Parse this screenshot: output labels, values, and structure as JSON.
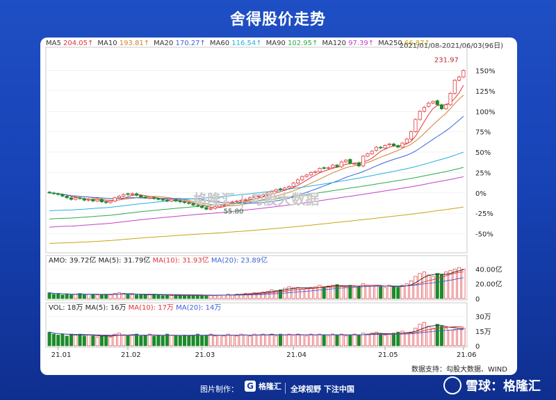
{
  "page": {
    "title": "舍得股价走势",
    "source": "数据支持：勾股大数据、WIND",
    "watermark": "格隆汇 | 勾股大数据"
  },
  "footer": {
    "made_by": "图片制作：",
    "brand": "格隆汇",
    "slogan": "全球视野 下注中国",
    "xueqiu": "雪球：格隆汇"
  },
  "ma_legend": [
    {
      "label": "MA5",
      "value": "204.05↑",
      "color": "#e0343a"
    },
    {
      "label": "MA10",
      "value": "193.81↑",
      "color": "#d08030"
    },
    {
      "label": "MA20",
      "value": "170.27↑",
      "color": "#3a62d8"
    },
    {
      "label": "MA60",
      "value": "116.54↑",
      "color": "#25aee0"
    },
    {
      "label": "MA90",
      "value": "102.95↑",
      "color": "#2ca84a"
    },
    {
      "label": "MA120",
      "value": "97.39↑",
      "color": "#c040c8"
    },
    {
      "label": "MA250",
      "value": "66.87↑",
      "color": "#c8a414"
    }
  ],
  "date_range": "2021/01/08-2021/06/03(96日)",
  "chart_data": [
    {
      "type": "candlestick",
      "yaxis": {
        "ticks": [
          "150%",
          "125%",
          "100%",
          "75%",
          "50%",
          "25%",
          "0%",
          "-25%",
          "-50%"
        ],
        "values": [
          150,
          125,
          100,
          75,
          50,
          25,
          0,
          -25,
          -50
        ],
        "ylim": [
          -70,
          170
        ]
      },
      "annotations": [
        {
          "text": "231.97",
          "x": 95,
          "y": 162
        },
        {
          "text": "55.80",
          "x": 39,
          "y": -20
        }
      ],
      "x_ticks": [
        {
          "label": "21.01",
          "x": 2
        },
        {
          "label": "21.02",
          "x": 18
        },
        {
          "label": "21.03",
          "x": 35
        },
        {
          "label": "21.04",
          "x": 56
        },
        {
          "label": "21.05",
          "x": 77
        },
        {
          "label": "21.06",
          "x": 95
        }
      ],
      "n": 96,
      "closes": [
        0,
        -1,
        -2,
        -4,
        -6,
        -8,
        -6,
        -7,
        -9,
        -8,
        -10,
        -8,
        -11,
        -12,
        -10,
        -6,
        -4,
        -2,
        -2,
        -1,
        -3,
        -5,
        -6,
        -6,
        -7,
        -8,
        -9,
        -10,
        -8,
        -10,
        -11,
        -12,
        -13,
        -15,
        -16,
        -18,
        -20,
        -19,
        -17,
        -15,
        -14,
        -12,
        -11,
        -10,
        -9,
        -8,
        -6,
        -5,
        -4,
        -2,
        0,
        2,
        4,
        4,
        6,
        8,
        12,
        16,
        20,
        22,
        25,
        26,
        30,
        30,
        31,
        34,
        32,
        38,
        40,
        36,
        36,
        33,
        45,
        48,
        51,
        56,
        55,
        58,
        60,
        58,
        56,
        61,
        66,
        75,
        90,
        100,
        105,
        110,
        112,
        108,
        103,
        108,
        122,
        138,
        142,
        150
      ],
      "opens": [
        1,
        0,
        -1,
        -2,
        -4,
        -6,
        -8,
        -6,
        -7,
        -9,
        -8,
        -10,
        -8,
        -11,
        -12,
        -10,
        -6,
        -4,
        -1,
        -2,
        -1,
        -3,
        -5,
        -6,
        -6,
        -7,
        -8,
        -9,
        -10,
        -8,
        -10,
        -11,
        -12,
        -13,
        -15,
        -16,
        -18,
        -20,
        -19,
        -17,
        -15,
        -14,
        -12,
        -11,
        -10,
        -9,
        -8,
        -6,
        -5,
        -4,
        -2,
        0,
        2,
        5,
        4,
        6,
        8,
        12,
        16,
        20,
        22,
        25,
        26,
        31,
        30,
        31,
        34,
        32,
        38,
        41,
        36,
        37,
        33,
        45,
        48,
        52,
        56,
        55,
        59,
        60,
        58,
        56,
        61,
        66,
        75,
        90,
        100,
        106,
        110,
        113,
        108,
        103,
        108,
        122,
        138,
        142
      ]
    },
    {
      "type": "bar",
      "title": "AMO: 39.72亿",
      "legend": [
        {
          "label": "MA(5): 31.79亿",
          "color": "#222"
        },
        {
          "label": "MA(10): 31.93亿",
          "color": "#e0343a"
        },
        {
          "label": "MA(20): 23.89亿",
          "color": "#3a62d8"
        }
      ],
      "yaxis": {
        "ticks": [
          "40.00亿",
          "20.00亿",
          "0"
        ],
        "values": [
          40,
          20,
          0
        ],
        "ylim": [
          0,
          45
        ]
      },
      "values": [
        8,
        6,
        7,
        5,
        6,
        5,
        6,
        7,
        5,
        6,
        6,
        5,
        5,
        6,
        5,
        7,
        8,
        7,
        6,
        5,
        5,
        6,
        5,
        5,
        6,
        5,
        4,
        5,
        4,
        5,
        4,
        4,
        5,
        4,
        4,
        5,
        4,
        5,
        4,
        5,
        5,
        6,
        5,
        6,
        6,
        7,
        7,
        8,
        8,
        9,
        10,
        12,
        11,
        12,
        14,
        16,
        15,
        15,
        13,
        14,
        15,
        16,
        18,
        16,
        17,
        18,
        19,
        17,
        16,
        18,
        16,
        17,
        20,
        18,
        18,
        17,
        16,
        15,
        18,
        16,
        15,
        18,
        20,
        24,
        30,
        34,
        36,
        32,
        30,
        34,
        32,
        36,
        38,
        40,
        42,
        40
      ]
    },
    {
      "type": "bar",
      "title": "VOL: 18万",
      "legend": [
        {
          "label": "MA(5): 16万",
          "color": "#222"
        },
        {
          "label": "MA(10): 17万",
          "color": "#e0343a"
        },
        {
          "label": "MA(20): 14万",
          "color": "#3a62d8"
        }
      ],
      "yaxis": {
        "ticks": [
          "30万",
          "15万",
          "0"
        ],
        "values": [
          30,
          15,
          0
        ],
        "ylim": [
          0,
          34
        ]
      },
      "values": [
        14,
        12,
        11,
        12,
        10,
        12,
        11,
        12,
        10,
        11,
        10,
        9,
        10,
        11,
        9,
        12,
        13,
        11,
        10,
        11,
        12,
        10,
        11,
        12,
        10,
        11,
        10,
        12,
        11,
        10,
        10,
        11,
        10,
        11,
        12,
        10,
        11,
        12,
        10,
        11,
        10,
        12,
        11,
        10,
        12,
        11,
        10,
        12,
        11,
        12,
        11,
        12,
        10,
        12,
        11,
        12,
        11,
        12,
        11,
        10,
        12,
        11,
        12,
        11,
        10,
        12,
        11,
        12,
        10,
        11,
        12,
        11,
        13,
        12,
        13,
        14,
        12,
        11,
        12,
        13,
        14,
        15,
        13,
        14,
        18,
        22,
        24,
        20,
        18,
        22,
        20,
        18,
        16,
        17,
        18,
        18
      ]
    }
  ]
}
